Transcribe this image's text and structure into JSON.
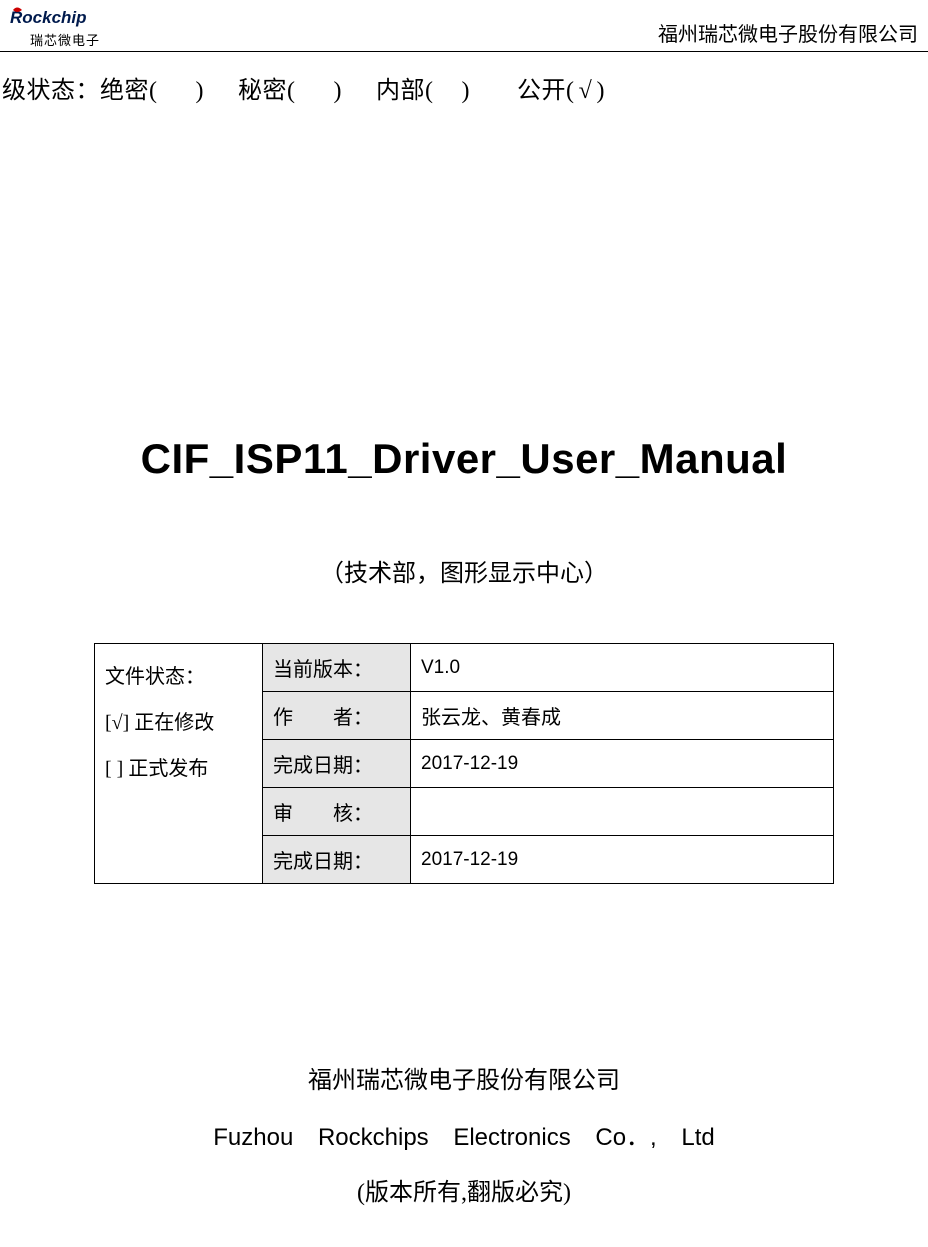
{
  "header": {
    "logo_text": "Rockchip",
    "logo_sub": "瑞芯微电子",
    "company": "福州瑞芯微电子股份有限公司"
  },
  "classification": {
    "prefix": "级状态：",
    "topsecret_label": "绝密",
    "topsecret_mark": "",
    "secret_label": "秘密",
    "secret_mark": "",
    "internal_label": "内部",
    "internal_mark": "",
    "public_label": "公开",
    "public_mark": "√"
  },
  "title": "CIF_ISP11_Driver_User_Manual",
  "subtitle": "（技术部，图形显示中心）",
  "status": {
    "heading": "文件状态：",
    "editing": "[√] 正在修改",
    "released": "[   ] 正式发布"
  },
  "table": {
    "rows": [
      {
        "label": "当前版本：",
        "value": "V1.0",
        "cjk": false
      },
      {
        "label": "作　　者：",
        "value": "张云龙、黄春成",
        "cjk": true
      },
      {
        "label": "完成日期：",
        "value": "2017-12-19",
        "cjk": false
      },
      {
        "label": "审　　核：",
        "value": "",
        "cjk": false
      },
      {
        "label": "完成日期：",
        "value": "2017-12-19",
        "cjk": false
      }
    ]
  },
  "footer": {
    "company_cn": "福州瑞芯微电子股份有限公司",
    "company_en": "Fuzhou Rockchips Electronics Co．, Ltd",
    "copyright": "(版本所有,翻版必究)"
  }
}
